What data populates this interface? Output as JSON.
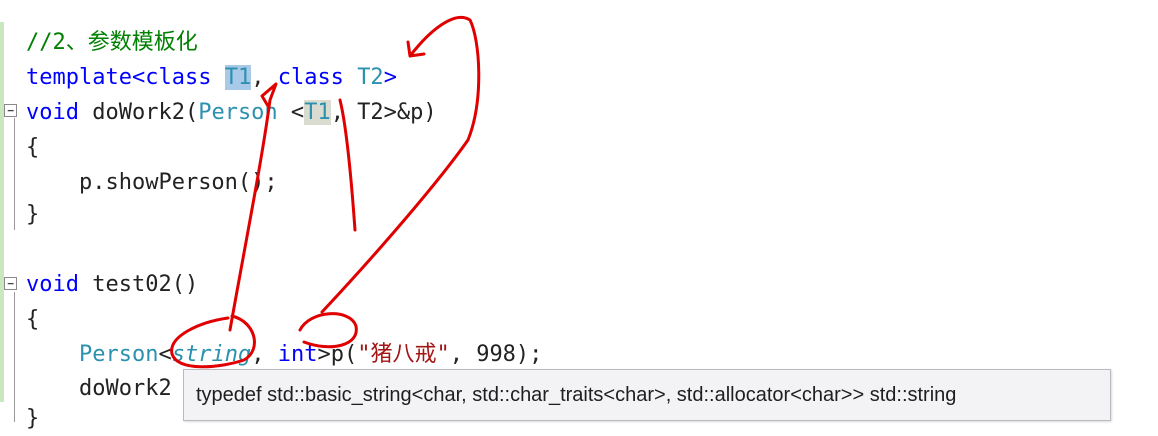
{
  "code_lines": {
    "l1": {
      "comment": "//2、参数模板化"
    },
    "l2": {
      "kw": "template",
      "open": "<",
      "class1": "class",
      "sp1": " ",
      "T1": "T1",
      "comma": ",",
      "sp2": " ",
      "class2": "class",
      "sp3": " ",
      "T2": "T2",
      "close": ">"
    },
    "l3": {
      "kw": "void",
      "sp": " ",
      "name": "doWork2(",
      "type": "Person",
      "rest1": " <",
      "T1": "T1",
      "rest2": ", T2>&p)"
    },
    "l4": {
      "text": "{"
    },
    "l5": {
      "indent": "    ",
      "text": "p.showPerson();"
    },
    "l6": {
      "text": "}"
    },
    "l7": {
      "kw": "void",
      "sp": " ",
      "text": "test02()"
    },
    "l8": {
      "text": "{"
    },
    "l9": {
      "indent": "    ",
      "type": "Person",
      "lt": "<",
      "string": "string",
      "comma": ", ",
      "int": "int",
      "gt": ">p(",
      "str": "\"猪八戒\"",
      "rest": ", 998);"
    },
    "l10": {
      "indent": "    ",
      "text": "doWork2"
    },
    "l11": {
      "text": "}"
    }
  },
  "tooltip": {
    "text": "typedef std::basic_string<char, std::char_traits<char>, std::allocator<char>> std::string"
  },
  "colors": {
    "keyword": "#0000ff",
    "type": "#2b91af",
    "comment": "#008000",
    "string": "#a31515",
    "annotation": "#e00000"
  }
}
